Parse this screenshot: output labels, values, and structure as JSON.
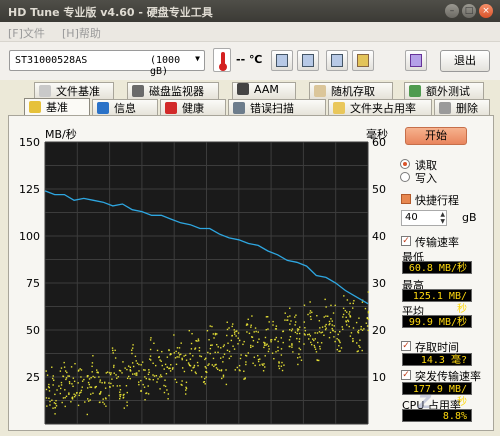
{
  "window": {
    "title": "HD Tune 专业版 v4.60 - 硬盘专业工具"
  },
  "menu": {
    "file": "[F]文件",
    "help": "[H]帮助"
  },
  "toolbar": {
    "drive_name": "ST31000528AS",
    "drive_size": "(1000 gB)",
    "temperature": "-- ℃",
    "exit_label": "退出"
  },
  "tabs_top": [
    "文件基准",
    "磁盘监视器",
    "AAM",
    "随机存取",
    "额外测试"
  ],
  "tabs_bottom": [
    "基准",
    "信息",
    "健康",
    "错误扫描",
    "文件夹占用率",
    "删除"
  ],
  "selected_tab": "基准",
  "controls": {
    "start_label": "开始",
    "read_label": "读取",
    "write_label": "写入",
    "short_stroke_label": "快捷行程",
    "short_stroke_value": "40",
    "short_stroke_unit": "gB",
    "transfer_rate_label": "传输速率",
    "min_label": "最低",
    "min_value": "60.8 MB/秒",
    "max_label": "最高",
    "max_value": "125.1 MB/秒",
    "avg_label": "平均",
    "avg_value": "99.9 MB/秒",
    "access_time_label": "存取时间",
    "access_time_value": "14.3 毫?",
    "burst_label": "突发传输速率",
    "burst_value": "177.9 MB/秒",
    "cpu_label": "CPU 占用率",
    "cpu_value": "8.8%"
  },
  "colors": {
    "chart_bg": "#1a1a1a",
    "grid": "#3c3c3c",
    "line": "#2ea6e0",
    "dots": "#e4df35",
    "accent": "#e98a5e"
  },
  "chart_data": {
    "type": "line",
    "ylabel_left": "MB/秒",
    "ylabel_right": "毫秒",
    "ylim_left": [
      0,
      150
    ],
    "ylim_right": [
      0,
      60
    ],
    "yticks_left": [
      "150",
      "125",
      "100",
      "75",
      "50",
      "25"
    ],
    "yticks_right": [
      "60",
      "50",
      "40",
      "30",
      "20",
      "10"
    ],
    "grid": true,
    "series": [
      {
        "name": "transfer_rate",
        "x": [
          0,
          3,
          6,
          9,
          12,
          15,
          18,
          21,
          24,
          27,
          30,
          33,
          36,
          39,
          42,
          45,
          48,
          51,
          54,
          57,
          60,
          63,
          66,
          69,
          72,
          75,
          78,
          81,
          84,
          87,
          90,
          93,
          96,
          100
        ],
        "values": [
          124,
          122,
          122,
          119,
          120,
          119,
          118,
          116,
          117,
          114,
          113,
          111,
          111,
          109,
          107,
          106,
          104,
          104,
          101,
          99,
          98,
          96,
          95,
          92,
          90,
          87,
          86,
          84,
          79,
          78,
          75,
          71,
          68,
          64
        ]
      },
      {
        "name": "access_time",
        "points": [
          [
            1,
            8
          ],
          [
            3,
            6
          ],
          [
            5,
            9
          ],
          [
            7,
            7
          ],
          [
            9,
            10
          ],
          [
            11,
            8
          ],
          [
            13,
            6
          ],
          [
            15,
            11
          ],
          [
            17,
            9
          ],
          [
            19,
            7
          ],
          [
            21,
            12
          ],
          [
            23,
            10
          ],
          [
            25,
            8
          ],
          [
            27,
            13
          ],
          [
            29,
            11
          ],
          [
            31,
            9
          ],
          [
            33,
            14
          ],
          [
            35,
            12
          ],
          [
            37,
            10
          ],
          [
            39,
            15
          ],
          [
            41,
            13
          ],
          [
            43,
            11
          ],
          [
            45,
            16
          ],
          [
            47,
            14
          ],
          [
            49,
            12
          ],
          [
            51,
            17
          ],
          [
            53,
            15
          ],
          [
            55,
            13
          ],
          [
            57,
            18
          ],
          [
            59,
            16
          ],
          [
            61,
            14
          ],
          [
            63,
            19
          ],
          [
            65,
            17
          ],
          [
            67,
            15
          ],
          [
            69,
            20
          ],
          [
            71,
            18
          ],
          [
            73,
            16
          ],
          [
            75,
            21
          ],
          [
            77,
            19
          ],
          [
            79,
            17
          ],
          [
            81,
            22
          ],
          [
            83,
            20
          ],
          [
            85,
            18
          ],
          [
            87,
            23
          ],
          [
            89,
            21
          ],
          [
            91,
            19
          ],
          [
            93,
            24
          ],
          [
            95,
            22
          ],
          [
            97,
            20
          ],
          [
            99,
            24
          ]
        ]
      }
    ]
  }
}
